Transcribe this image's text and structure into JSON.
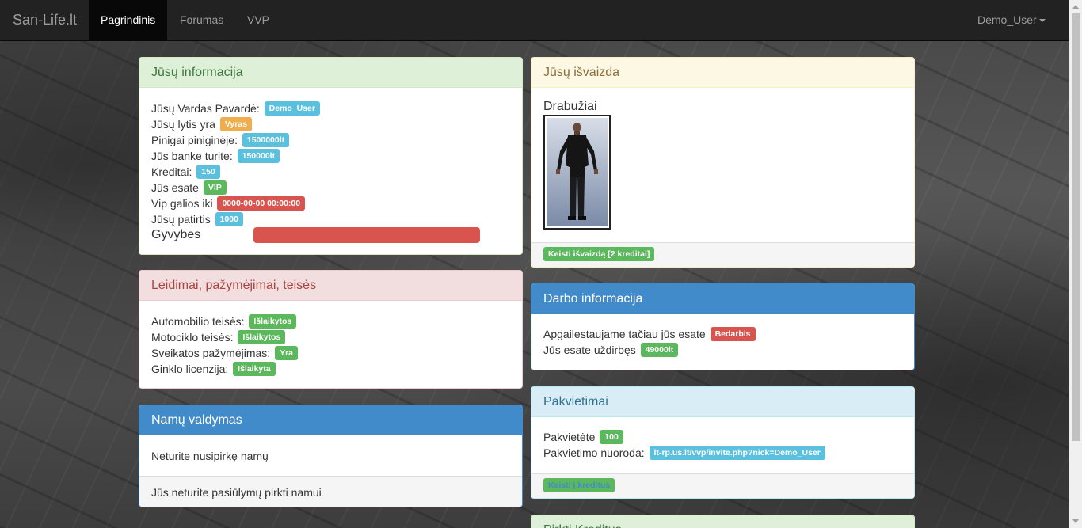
{
  "navbar": {
    "brand": "San-Life.lt",
    "items": [
      {
        "label": "Pagrindinis"
      },
      {
        "label": "Forumas"
      },
      {
        "label": "VVP"
      }
    ],
    "user": "Demo_User"
  },
  "info_panel": {
    "title": "Jūsų informacija",
    "rows": [
      {
        "label": "Jūsų Vardas Pavardė:",
        "value": "Demo_User"
      },
      {
        "label": "Jūsų lytis yra",
        "value": "Vyras"
      },
      {
        "label": "Pinigai piniginėje:",
        "value": "1500000lt"
      },
      {
        "label": "Jūs banke turite:",
        "value": "150000lt"
      },
      {
        "label": "Kreditai:",
        "value": "150"
      },
      {
        "label": "Jūs esate",
        "value": "VIP"
      },
      {
        "label": "Vip galios iki",
        "value": "0000-00-00 00:00:00"
      },
      {
        "label": "Jūsų patirtis",
        "value": "1000"
      }
    ],
    "health_label": "Gyvybes",
    "health_fraction": 1.0,
    "colors": {
      "info": "#5bc0de",
      "warning": "#f0ad4e",
      "success": "#5cb85c",
      "danger": "#d9534f"
    }
  },
  "licenses_panel": {
    "title": "Leidimai, pažymėjimai, teisės",
    "rows": [
      {
        "label": "Automobilio teisės:",
        "value": "Išlaikytos"
      },
      {
        "label": "Motociklo teisės:",
        "value": "Išlaikytos"
      },
      {
        "label": "Sveikatos pažymėjimas:",
        "value": "Yra"
      },
      {
        "label": "Ginklo licenzija:",
        "value": "Išlaikyta"
      }
    ]
  },
  "houses_panel": {
    "title": "Namų valdymas",
    "body": "Neturite nusipirkę namų",
    "footer": "Jūs neturite pasiūlymų pirkti namui"
  },
  "appearance_panel": {
    "title": "Jūsų išvaizda",
    "clothes_label": "Drabužiai",
    "button": "Keisti išvaizdą [2 kreditai]"
  },
  "work_panel": {
    "title": "Darbo informacija",
    "rows": [
      {
        "label": "Apgailestaujame tačiau jūs esate",
        "value": "Bedarbis"
      },
      {
        "label": "Jūs esate uždirbęs",
        "value": "49000lt"
      }
    ]
  },
  "invites_panel": {
    "title": "Pakvietimai",
    "rows": [
      {
        "label": "Pakvietėte",
        "value": "100"
      },
      {
        "label": "Pakvietimo nuoroda:",
        "value": "lt-rp.us.lt/vvp/invite.php?nick=Demo_User"
      }
    ],
    "button": "Keisti į kreditus"
  },
  "buy_credits_panel": {
    "title": "Pirkti Kreditus"
  }
}
